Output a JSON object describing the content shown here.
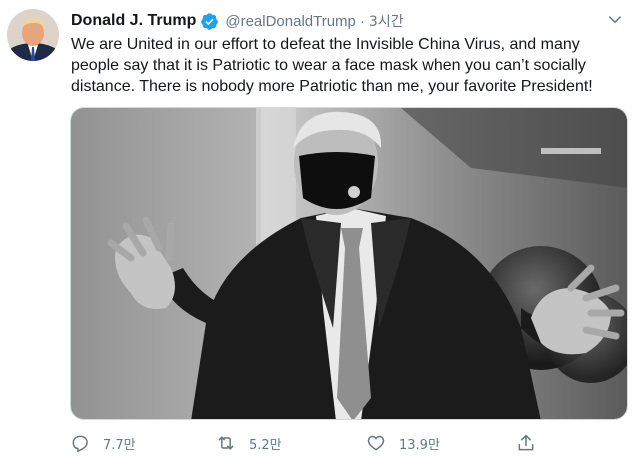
{
  "tweet": {
    "display_name": "Donald J. Trump",
    "handle": "@realDonaldTrump",
    "separator": "·",
    "time": "3시간",
    "verified_icon": "verified-badge-icon",
    "text_lines": [
      "We are United in our effort to defeat the Invisible China Virus, and many",
      "people say that it is Patriotic to wear a face mask when you can’t socially",
      "distance. There is nobody more Patriotic than me, your favorite President!"
    ]
  },
  "actions": {
    "reply_count": "7.7만",
    "retweet_count": "5.2만",
    "like_count": "13.9만"
  },
  "colors": {
    "accent": "#1da1f2",
    "secondary_text": "#657786",
    "primary_text": "#14171a"
  }
}
